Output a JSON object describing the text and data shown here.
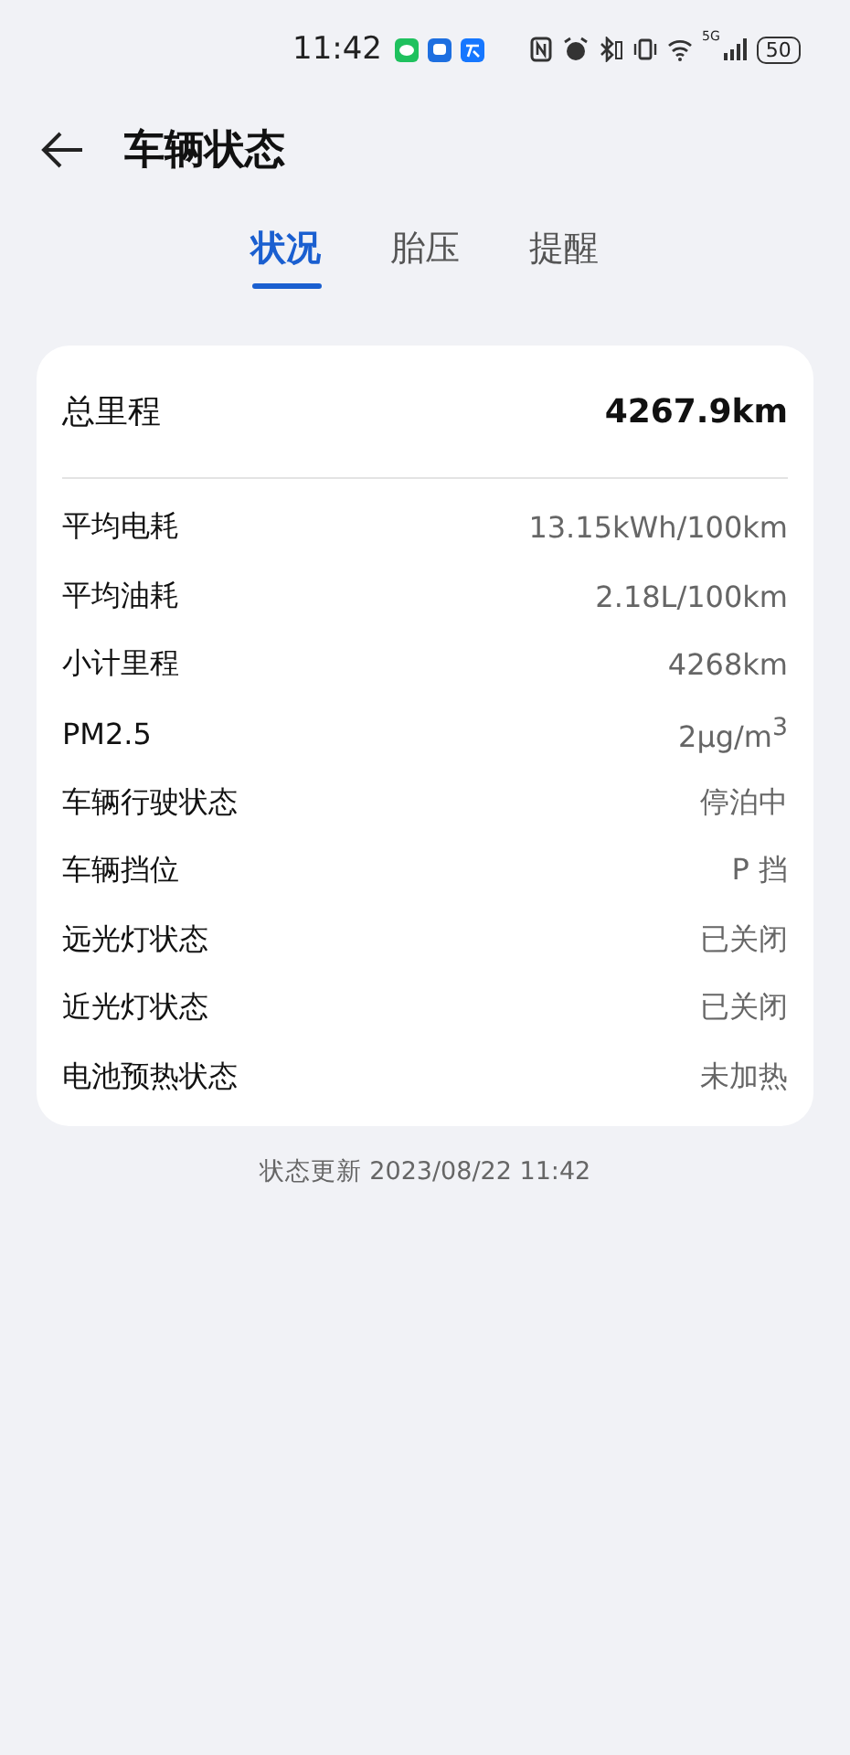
{
  "status_bar": {
    "time": "11:42",
    "network": "5G",
    "battery": "50"
  },
  "header": {
    "title": "车辆状态"
  },
  "tabs": [
    {
      "label": "状况",
      "selected": true
    },
    {
      "label": "胎压",
      "selected": false
    },
    {
      "label": "提醒",
      "selected": false
    }
  ],
  "total": {
    "label": "总里程",
    "value": "4267.9km"
  },
  "rows": [
    {
      "label": "平均电耗",
      "value": "13.15kWh/100km"
    },
    {
      "label": "平均油耗",
      "value": "2.18L/100km"
    },
    {
      "label": "小计里程",
      "value": "4268km"
    },
    {
      "label": "PM2.5",
      "value": "2μg/m$^{3}$"
    },
    {
      "label": "车辆行驶状态",
      "value": "停泊中"
    },
    {
      "label": "车辆挡位",
      "value": "P 挡"
    },
    {
      "label": "远光灯状态",
      "value": "已关闭"
    },
    {
      "label": "近光灯状态",
      "value": "已关闭"
    },
    {
      "label": "电池预热状态",
      "value": "未加热"
    }
  ],
  "updated": "状态更新 2023/08/22 11:42"
}
